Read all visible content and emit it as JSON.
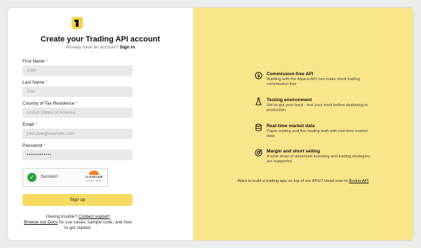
{
  "header": {
    "title": "Create your Trading API account",
    "subtitle_prefix": "Already have an account?",
    "signin_link": "Sign in"
  },
  "form": {
    "first_name_label": "First Name",
    "first_name_placeholder": "John",
    "last_name_label": "Last Name",
    "last_name_placeholder": "Doe",
    "country_label": "Country of Tax Residence",
    "country_value": "United States of America",
    "email_label": "Email",
    "email_placeholder": "john.doe@example.com",
    "password_label": "Password",
    "password_value": "•••••••••••••",
    "required_mark": "*"
  },
  "captcha": {
    "status": "Success!",
    "brand": "CLOUDFLARE",
    "links": "Privacy · Terms"
  },
  "signup_label": "Sign up",
  "help": {
    "trouble_prefix": "Having trouble?",
    "contact_link": "Contact support",
    "docs_link": "Browse our Docs",
    "docs_suffix_1": "for use cases, sample code, and how",
    "docs_suffix_2": "to get started."
  },
  "features": [
    {
      "icon": "dollar-coin-icon",
      "title": "Commission-free API",
      "desc": "Building with the Alpaca API can make stock trading commission-free"
    },
    {
      "icon": "flask-icon",
      "title": "Testing environment",
      "desc": "We've got your back - test your work before deploying to production"
    },
    {
      "icon": "database-icon",
      "title": "Real-time market data",
      "desc": "Paper trading and live trading both with real-time market data"
    },
    {
      "icon": "target-icon",
      "title": "Margin and short selling",
      "desc": "A wide array of advanced investing and trading strategies are supported"
    }
  ],
  "cta": {
    "text": "Want to build a trading app on top of our APIs? Head over to",
    "link": "Broker API"
  },
  "colors": {
    "accent": "#f9e58a",
    "button": "#f6db63",
    "success": "#2e9e3b"
  }
}
